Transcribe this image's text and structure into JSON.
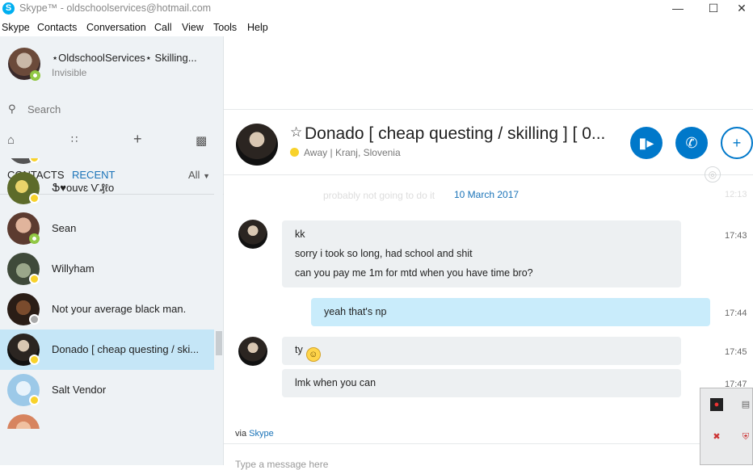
{
  "window": {
    "title": "Skype™ - oldschoolservices@hotmail.com",
    "minimize": "—",
    "maximize": "☐",
    "close": "✕"
  },
  "menu": [
    "Skype",
    "Contacts",
    "Conversation",
    "Call",
    "View",
    "Tools",
    "Help"
  ],
  "profile": {
    "name": "⋆OldschoolServices⋆ Skilling...",
    "status": "Invisible"
  },
  "search": {
    "placeholder": "Search"
  },
  "tabs": {
    "contacts": "CONTACTS",
    "recent": "RECENT",
    "filter": "All"
  },
  "contacts": [
    {
      "name": "",
      "status": "away"
    },
    {
      "name": "Ֆ♥ouvɛ Ѵ₰ℓo",
      "status": "away"
    },
    {
      "name": "Sean",
      "status": "online"
    },
    {
      "name": "Willyham",
      "status": "away"
    },
    {
      "name": "Not your average black man.",
      "status": "unknown"
    },
    {
      "name": "Donado [ cheap questing / ski...",
      "status": "away",
      "selected": true
    },
    {
      "name": "Salt Vendor",
      "status": "away"
    }
  ],
  "conversation": {
    "title": "Donado [ cheap questing / skilling ] [ 0...",
    "status": "Away",
    "location": "Kranj, Slovenia",
    "date": "10 March 2017",
    "ghost_text": "probably not going to do it",
    "ghost_time": "12:13",
    "messages": [
      {
        "lines": [
          "kk",
          "sorry i took so long, had school and shit",
          "can you pay me 1m for mtd when you have time bro?"
        ],
        "time": "17:43",
        "mine": false
      },
      {
        "lines": [
          "yeah that's np"
        ],
        "time": "17:44",
        "mine": true
      },
      {
        "lines": [
          "ty"
        ],
        "time": "17:45",
        "mine": false,
        "emoji": true
      },
      {
        "lines": [
          "lmk when you can"
        ],
        "time": "17:47",
        "mine": false
      }
    ],
    "via_label": "via",
    "via_link": "Skype",
    "composer_placeholder": "Type a message here"
  },
  "icons": {
    "video": "video-call-icon",
    "call": "phone-icon",
    "add": "add-contact-icon"
  }
}
